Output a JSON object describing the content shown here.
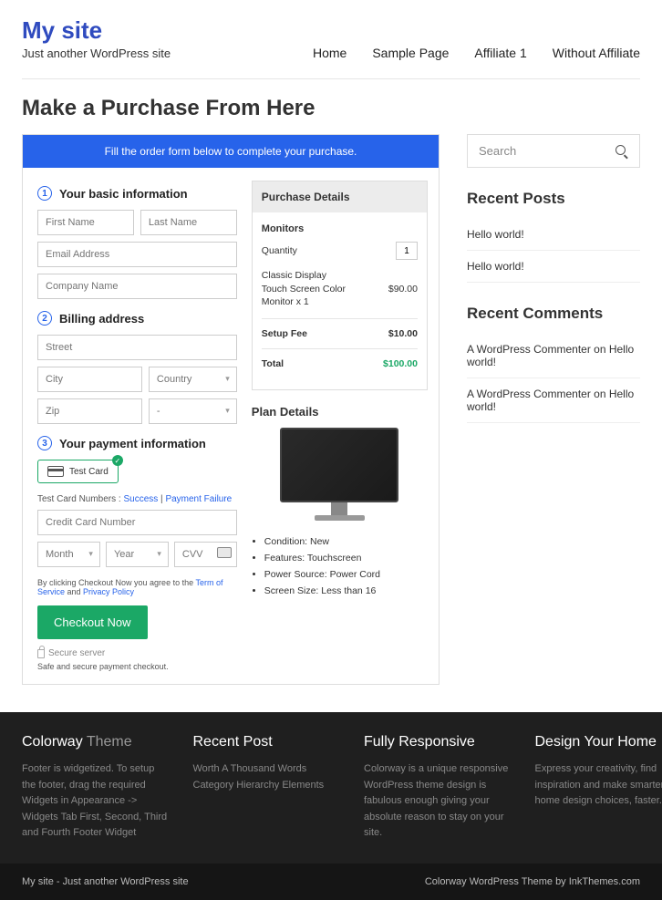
{
  "site": {
    "title": "My site",
    "tagline": "Just another WordPress site"
  },
  "nav": [
    "Home",
    "Sample Page",
    "Affiliate 1",
    "Without Affiliate"
  ],
  "page": {
    "title": "Make a Purchase From Here"
  },
  "checkout": {
    "banner": "Fill the order form below to complete your purchase.",
    "sections": {
      "basic": "Your basic information",
      "billing": "Billing address",
      "payment": "Your payment information"
    },
    "placeholders": {
      "first": "First Name",
      "last": "Last Name",
      "email": "Email Address",
      "company": "Company Name",
      "street": "Street",
      "city": "City",
      "country": "Country",
      "zip": "Zip",
      "state": "-",
      "cc": "Credit Card Number",
      "month": "Month",
      "year": "Year",
      "cvv": "CVV"
    },
    "test_card": "Test  Card",
    "test_numbers_label": "Test Card Numbers :",
    "success": "Success",
    "failure": "Payment Failure",
    "legal_pre": "By clicking Checkout Now you agree to the ",
    "tos": "Term of Service",
    "and": " and ",
    "privacy": "Privacy Policy",
    "button": "Checkout Now",
    "secure": "Secure server",
    "safe": "Safe and secure payment checkout."
  },
  "purchase": {
    "heading": "Purchase Details",
    "group": "Monitors",
    "qty_label": "Quantity",
    "qty": "1",
    "item": "Classic Display Touch Screen Color Monitor x 1",
    "item_price": "$90.00",
    "setup_label": "Setup Fee",
    "setup_price": "$10.00",
    "total_label": "Total",
    "total_price": "$100.00"
  },
  "plan": {
    "heading": "Plan Details",
    "bullets": [
      "Condition: New",
      "Features: Touchscreen",
      "Power Source: Power Cord",
      "Screen Size: Less than 16"
    ]
  },
  "sidebar": {
    "search": "Search",
    "recent_posts": {
      "heading": "Recent Posts",
      "items": [
        "Hello world!",
        "Hello world!"
      ]
    },
    "recent_comments": {
      "heading": "Recent Comments",
      "items": [
        {
          "author": "A WordPress Commenter",
          "on": " on ",
          "post": "Hello world!"
        },
        {
          "author": "A WordPress Commenter",
          "on": " on ",
          "post": "Hello world!"
        }
      ]
    }
  },
  "footer": {
    "cols": [
      {
        "title": "Colorway",
        "suffix": " Theme",
        "text": "Footer is widgetized. To setup the footer, drag the required Widgets in Appearance -> Widgets Tab First, Second, Third and Fourth Footer Widget"
      },
      {
        "title": "Recent Post",
        "suffix": "",
        "text": "Worth A Thousand Words Category Hierarchy Elements"
      },
      {
        "title": "Fully Responsive",
        "suffix": "",
        "text": "Colorway is a unique responsive WordPress theme design is fabulous enough giving your absolute reason to stay on your site."
      },
      {
        "title": "Design Your Home",
        "suffix": "",
        "text": "Express your creativity, find inspiration and make smarter home design choices, faster."
      }
    ],
    "bar_left": "My site - Just another WordPress site",
    "bar_right": "Colorway WordPress Theme by InkThemes.com"
  }
}
